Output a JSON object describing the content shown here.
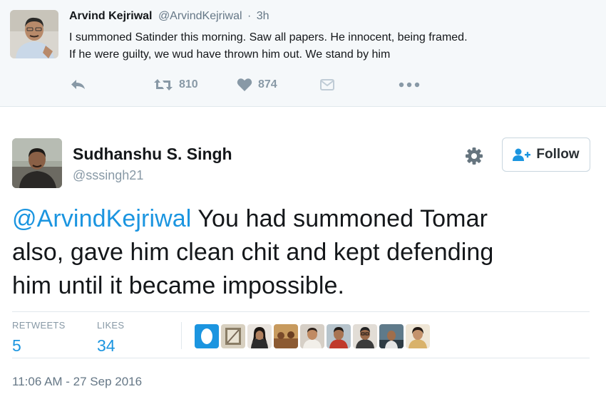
{
  "parent_tweet": {
    "name": "Arvind Kejriwal",
    "handle": "@ArvindKejriwal",
    "separator": "·",
    "time": "3h",
    "text_line1": "I summoned Satinder this morning. Saw all papers. He innocent, being framed.",
    "text_line2": "If he were guilty, we wud have thrown him out. We stand by him",
    "retweet_count": "810",
    "like_count": "874",
    "icons": [
      "reply-icon",
      "retweet-icon",
      "heart-icon",
      "direct-message-icon",
      "more-icon"
    ]
  },
  "tweet": {
    "name": "Sudhanshu S. Singh",
    "handle": "@sssingh21",
    "follow_label": "Follow",
    "mention": "@ArvindKejriwal",
    "text_rest1": " You had summoned Tomar",
    "text_line2": "also, gave him clean chit and kept defending",
    "text_line3": "him until it became impossible.",
    "retweets_label": "RETWEETS",
    "retweets_value": "5",
    "likes_label": "LIKES",
    "likes_value": "34",
    "timestamp": "11:06 AM - 27 Sep 2016",
    "icons": [
      "gear-icon",
      "follow-person-icon"
    ]
  },
  "colors": {
    "link_blue": "#1b95e0",
    "muted_gray": "#8899a6",
    "parent_bg": "#f5f8fa",
    "text_dark": "#14171a"
  }
}
